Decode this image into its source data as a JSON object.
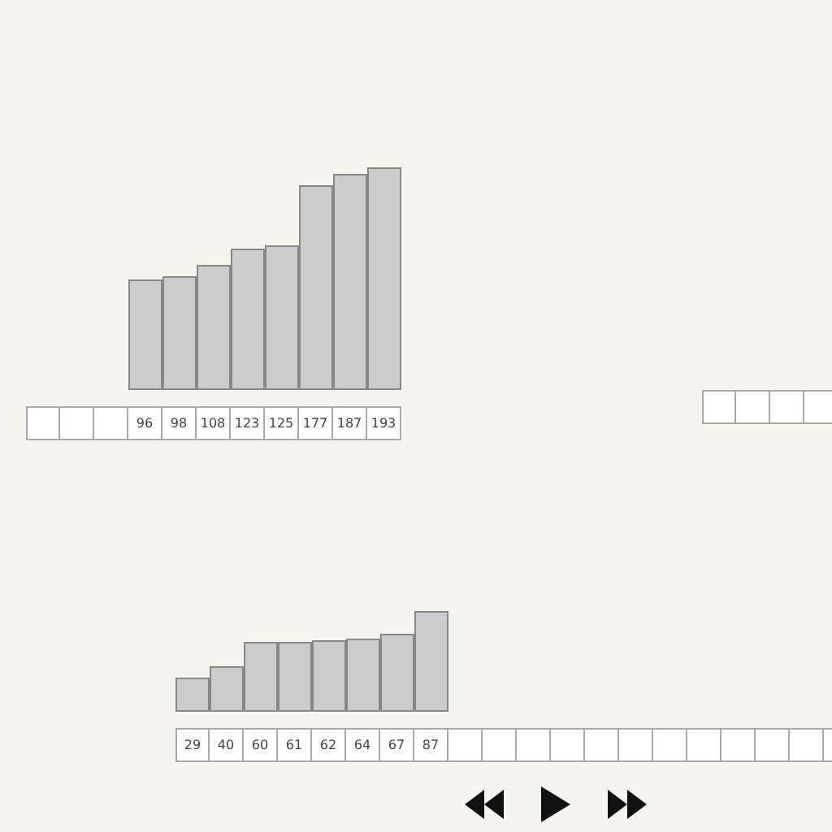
{
  "arrays": [
    {
      "cells": [
        {
          "kind": "empty"
        },
        {
          "kind": "empty"
        },
        {
          "kind": "empty"
        },
        {
          "kind": "value",
          "value": "96"
        },
        {
          "kind": "value",
          "value": "98"
        },
        {
          "kind": "value",
          "value": "108"
        },
        {
          "kind": "value",
          "value": "123"
        },
        {
          "kind": "value",
          "value": "125"
        },
        {
          "kind": "value",
          "value": "177"
        },
        {
          "kind": "value",
          "value": "187"
        },
        {
          "kind": "value",
          "value": "193"
        }
      ]
    },
    {
      "cells": [
        {
          "kind": "empty"
        },
        {
          "kind": "empty"
        },
        {
          "kind": "empty"
        },
        {
          "kind": "empty"
        }
      ]
    },
    {
      "cells": [
        {
          "kind": "value",
          "value": "29"
        },
        {
          "kind": "value",
          "value": "40"
        },
        {
          "kind": "value",
          "value": "60"
        },
        {
          "kind": "value",
          "value": "61"
        },
        {
          "kind": "value",
          "value": "62"
        },
        {
          "kind": "value",
          "value": "64"
        },
        {
          "kind": "value",
          "value": "67"
        },
        {
          "kind": "value",
          "value": "87"
        },
        {
          "kind": "empty"
        },
        {
          "kind": "empty"
        },
        {
          "kind": "empty"
        },
        {
          "kind": "empty"
        },
        {
          "kind": "empty"
        },
        {
          "kind": "empty"
        },
        {
          "kind": "empty"
        },
        {
          "kind": "empty"
        },
        {
          "kind": "empty"
        },
        {
          "kind": "empty"
        },
        {
          "kind": "empty"
        },
        {
          "kind": "empty"
        }
      ]
    }
  ],
  "controls": [
    {
      "kind": "rewind"
    },
    {
      "kind": "play"
    },
    {
      "kind": "fast-forward"
    }
  ]
}
